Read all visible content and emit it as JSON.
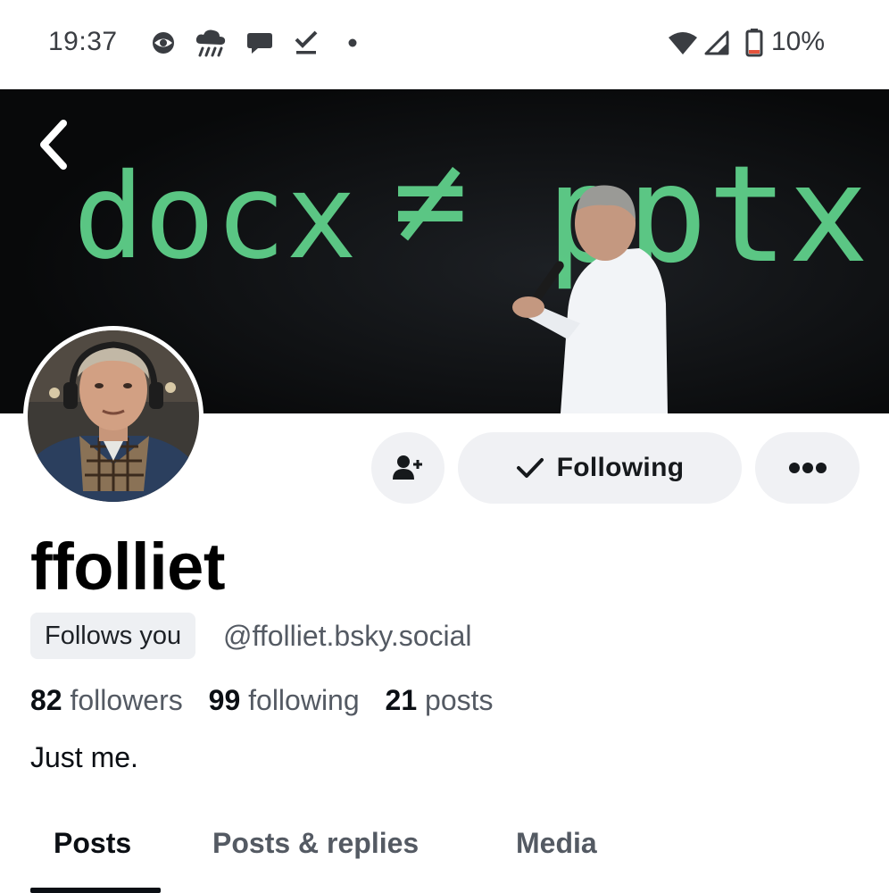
{
  "status_bar": {
    "time": "19:37",
    "battery": "10%",
    "icons": [
      "vpn-eye-icon",
      "rain-cloud-icon",
      "chat-bubble-icon",
      "download-done-icon",
      "dot-icon",
      "wifi-icon",
      "cell-signal-icon",
      "battery-icon"
    ]
  },
  "banner": {
    "text_left": "docx",
    "text_symbol": "≠",
    "text_right": "pptx"
  },
  "actions": {
    "add_user_icon": "person-add-icon",
    "following_label": "Following",
    "more_icon": "more-horizontal-icon"
  },
  "profile": {
    "display_name": "ffolliet",
    "follows_you_badge": "Follows you",
    "handle": "@ffolliet.bsky.social",
    "stats": {
      "followers_count": "82",
      "followers_label": "followers",
      "following_count": "99",
      "following_label": "following",
      "posts_count": "21",
      "posts_label": "posts"
    },
    "bio": "Just me."
  },
  "tabs": [
    {
      "label": "Posts",
      "active": true
    },
    {
      "label": "Posts & replies",
      "active": false
    },
    {
      "label": "Media",
      "active": false
    }
  ],
  "colors": {
    "accent_text": "#0b0f14",
    "muted_text": "#545a63",
    "button_bg": "#f0f1f4",
    "banner_green": "#5fd08a",
    "battery_low": "#e5533c"
  }
}
